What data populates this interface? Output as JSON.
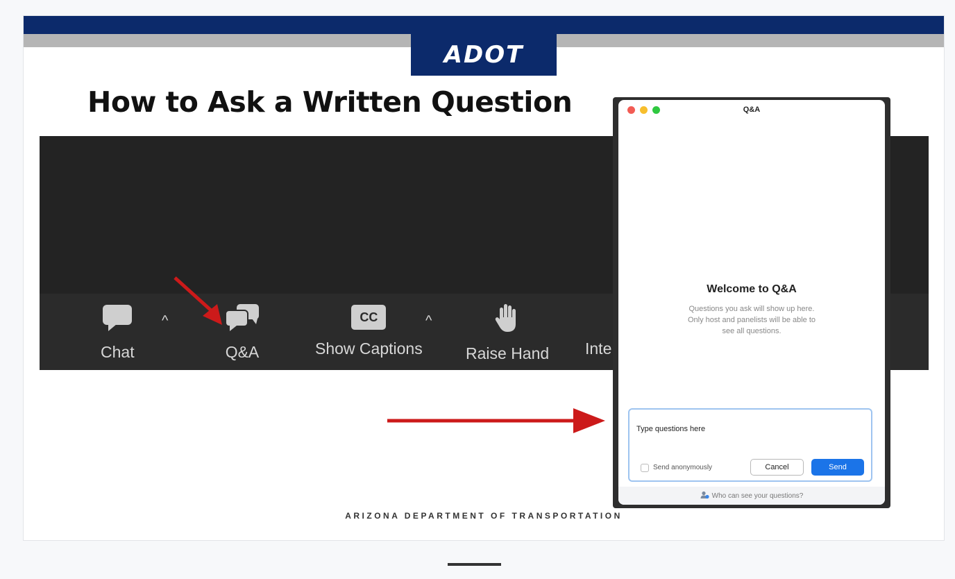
{
  "slide": {
    "logo": "ADOT",
    "title": "How to Ask a Written Question",
    "footer": "ARIZONA DEPARTMENT OF TRANSPORTATION"
  },
  "toolbar": {
    "items": [
      {
        "label": "Chat",
        "icon": "chat-bubble-icon"
      },
      {
        "label": "Q&A",
        "icon": "qa-bubbles-icon"
      },
      {
        "label": "Show Captions",
        "icon": "cc-icon",
        "icon_text": "CC"
      },
      {
        "label": "Raise Hand",
        "icon": "hand-icon"
      },
      {
        "label": "Inte",
        "icon": ""
      }
    ],
    "caret": "^"
  },
  "qa_window": {
    "title": "Q&A",
    "welcome_title": "Welcome to Q&A",
    "welcome_text": "Questions you ask will show up here. Only host and panelists will be able to see all questions.",
    "input_value": "Type questions here",
    "anonymous_label": "Send anonymously",
    "cancel_label": "Cancel",
    "send_label": "Send",
    "footer_link": "Who can see your questions?"
  },
  "colors": {
    "brand_navy": "#0c2a6b",
    "annotation_red": "#cc1a1a",
    "send_blue": "#1b74e8",
    "toolbar_dark": "#2b2b2b"
  }
}
